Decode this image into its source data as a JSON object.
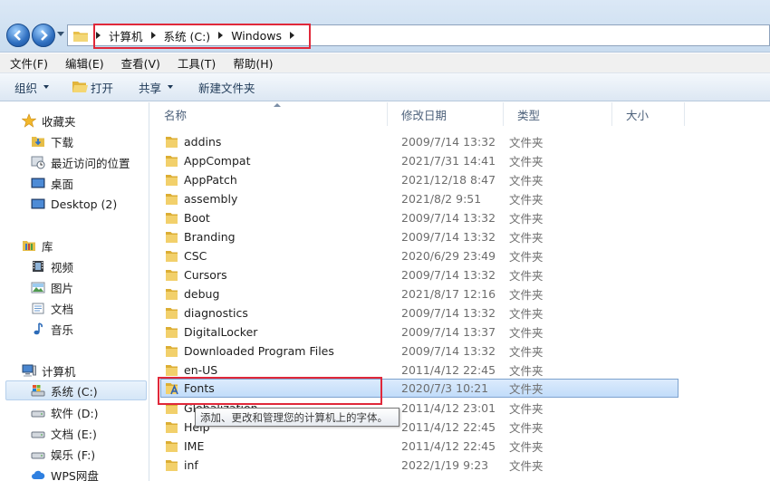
{
  "address": {
    "crumbs": [
      "计算机",
      "系统 (C:)",
      "Windows"
    ]
  },
  "menu": [
    "文件(F)",
    "编辑(E)",
    "查看(V)",
    "工具(T)",
    "帮助(H)"
  ],
  "commands": {
    "organize": "组织",
    "open": "打开",
    "share": "共享",
    "new_folder": "新建文件夹"
  },
  "nav": {
    "favorites": "收藏夹",
    "downloads": "下载",
    "recent": "最近访问的位置",
    "desktop": "桌面",
    "desktop2": "Desktop (2)",
    "libraries": "库",
    "videos": "视频",
    "pictures": "图片",
    "documents": "文档",
    "music": "音乐",
    "computer": "计算机",
    "drive_c": "系统 (C:)",
    "drive_d": "软件 (D:)",
    "drive_e": "文档 (E:)",
    "drive_f": "娱乐 (F:)",
    "wps": "WPS网盘"
  },
  "columns": {
    "name": "名称",
    "modified": "修改日期",
    "type": "类型",
    "size": "大小"
  },
  "files": [
    {
      "name": "addins",
      "date": "2009/7/14 13:32",
      "type": "文件夹"
    },
    {
      "name": "AppCompat",
      "date": "2021/7/31 14:41",
      "type": "文件夹"
    },
    {
      "name": "AppPatch",
      "date": "2021/12/18 8:47",
      "type": "文件夹"
    },
    {
      "name": "assembly",
      "date": "2021/8/2 9:51",
      "type": "文件夹"
    },
    {
      "name": "Boot",
      "date": "2009/7/14 13:32",
      "type": "文件夹"
    },
    {
      "name": "Branding",
      "date": "2009/7/14 13:32",
      "type": "文件夹"
    },
    {
      "name": "CSC",
      "date": "2020/6/29 23:49",
      "type": "文件夹"
    },
    {
      "name": "Cursors",
      "date": "2009/7/14 13:32",
      "type": "文件夹"
    },
    {
      "name": "debug",
      "date": "2021/8/17 12:16",
      "type": "文件夹"
    },
    {
      "name": "diagnostics",
      "date": "2009/7/14 13:32",
      "type": "文件夹"
    },
    {
      "name": "DigitalLocker",
      "date": "2009/7/14 13:37",
      "type": "文件夹"
    },
    {
      "name": "Downloaded Program Files",
      "date": "2009/7/14 13:32",
      "type": "文件夹"
    },
    {
      "name": "en-US",
      "date": "2011/4/12 22:45",
      "type": "文件夹"
    },
    {
      "name": "Fonts",
      "date": "2020/7/3 10:21",
      "type": "文件夹"
    },
    {
      "name": "Globalization",
      "date": "2011/4/12 23:01",
      "type": "文件夹"
    },
    {
      "name": "Help",
      "date": "2011/4/12 22:45",
      "type": "文件夹"
    },
    {
      "name": "IME",
      "date": "2011/4/12 22:45",
      "type": "文件夹"
    },
    {
      "name": "inf",
      "date": "2022/1/19 9:23",
      "type": "文件夹"
    }
  ],
  "tooltip": "添加、更改和管理您的计算机上的字体。"
}
